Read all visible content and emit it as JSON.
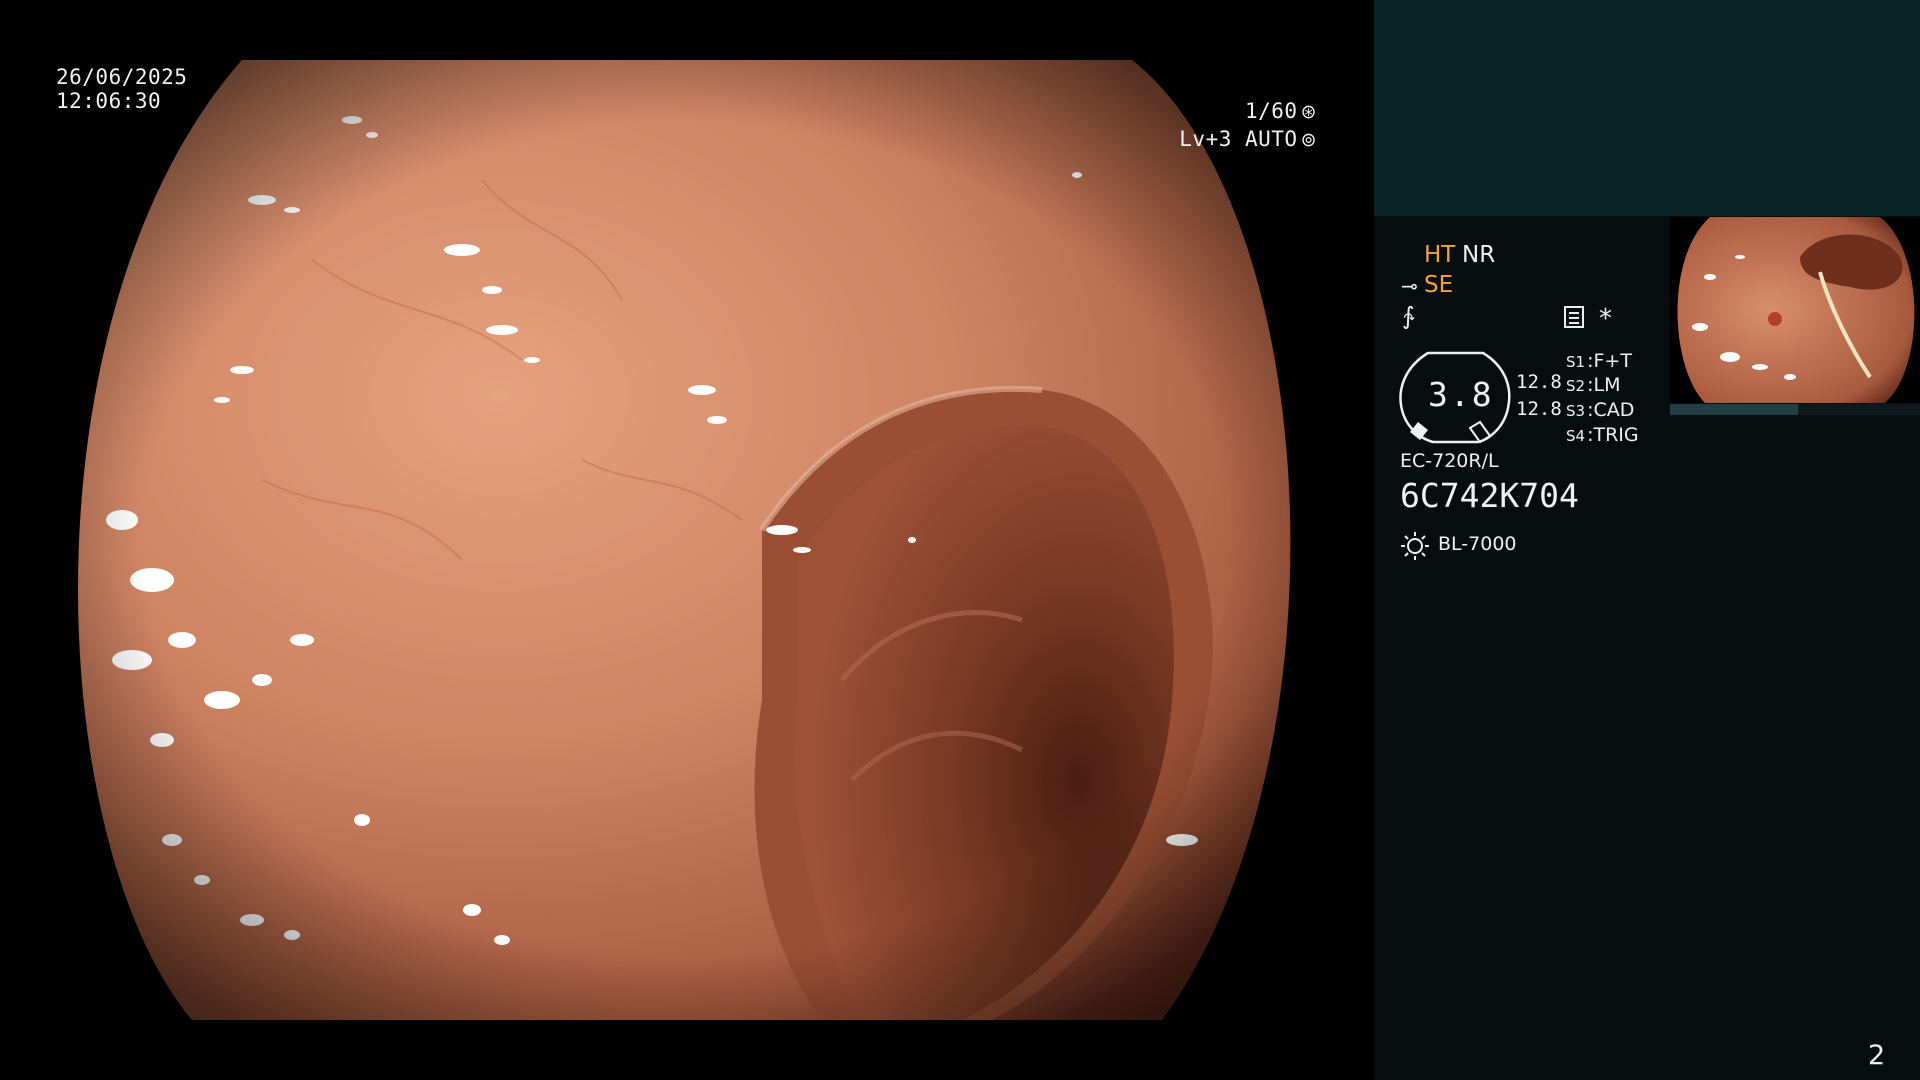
{
  "overlay": {
    "date": "26/06/2025",
    "time": "12:06:30",
    "shutter": "1/60",
    "shutter_icon": "shutter-icon",
    "iris": "Lv+3 AUTO",
    "iris_icon": "iris-icon"
  },
  "panel": {
    "ht": "HT",
    "nr": "NR",
    "se": "SE",
    "se_icon": "scope-tip-icon",
    "curve_icon": "curve-icon",
    "menu_icon": "menu-icon",
    "asterisk": "*",
    "gauge": {
      "value": "3.8",
      "side_values": [
        "12.8",
        "12.8"
      ]
    },
    "slots": [
      {
        "key": "S1",
        "value": "F+T"
      },
      {
        "key": "S2",
        "value": "LM"
      },
      {
        "key": "S3",
        "value": "CAD"
      },
      {
        "key": "S4",
        "value": "TRIG"
      }
    ],
    "scope_model": "EC-720R/L",
    "scope_serial": "6C742K704",
    "light_source_icon": "light-source-icon",
    "light_source": "BL-7000"
  },
  "page_number": "2",
  "colors": {
    "accent": "#f2a535",
    "panel_bg": "#070d0f",
    "panel_top": "#0b2427",
    "mucosa": "#c97d5f"
  }
}
